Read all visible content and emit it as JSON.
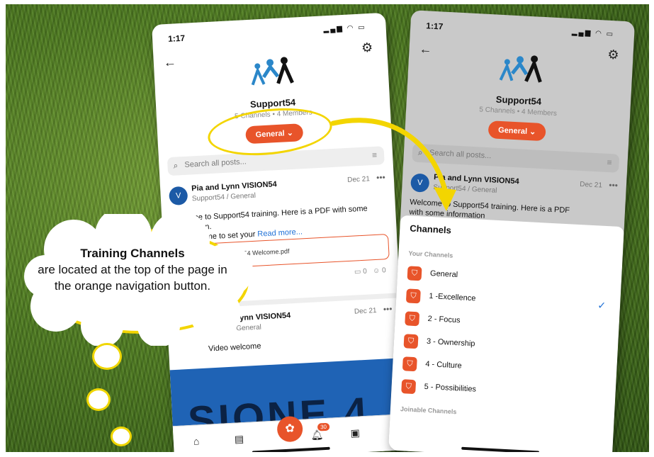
{
  "left_phone": {
    "time": "1:17",
    "group_name": "Support54",
    "group_meta": "5 Channels • 4 Members",
    "channel_pill": "General",
    "search_placeholder": "Search all posts...",
    "post1": {
      "author": "Pia and Lynn VISION54",
      "channel": "Support54 / General",
      "date": "Dec 21",
      "body": "Welcome to Support54 training. Here is a PDF with some information.",
      "body_line3": "is also a time to set your",
      "read_more": "Read more...",
      "attachment": "ON54 Support54 Welcome.pdf",
      "comments": "0",
      "reactions": "0"
    },
    "post2": {
      "author": "Lynn VISION54",
      "channel": "port54 / General",
      "date": "Dec 21",
      "body": "Video welcome"
    },
    "video_text": "SIONE 4",
    "notification_count": "30"
  },
  "right_phone": {
    "time": "1:17",
    "group_name": "Support54",
    "group_meta": "5 Channels • 4 Members",
    "channel_pill": "General",
    "search_placeholder": "Search all posts...",
    "post_author": "Pia and Lynn VISION54",
    "post_channel": "Support54 / General",
    "post_date": "Dec 21",
    "post_body": "Welcome to Support54 training. Here is a PDF",
    "post_body2": "with some information",
    "sheet": {
      "title": "Channels",
      "your_channels": "Your Channels",
      "joinable_channels": "Joinable Channels",
      "channels": [
        "General",
        "1 -Excellence",
        "2 - Focus",
        "3 - Ownership",
        "4 - Culture",
        "5 - Possibilities"
      ],
      "selected_index": 1
    }
  },
  "callout": {
    "title": "Training Channels",
    "text": "are located at the top of the page in the orange navigation button."
  },
  "colors": {
    "accent": "#e8542a",
    "highlight": "#f3d500",
    "link": "#1c6fd6"
  }
}
